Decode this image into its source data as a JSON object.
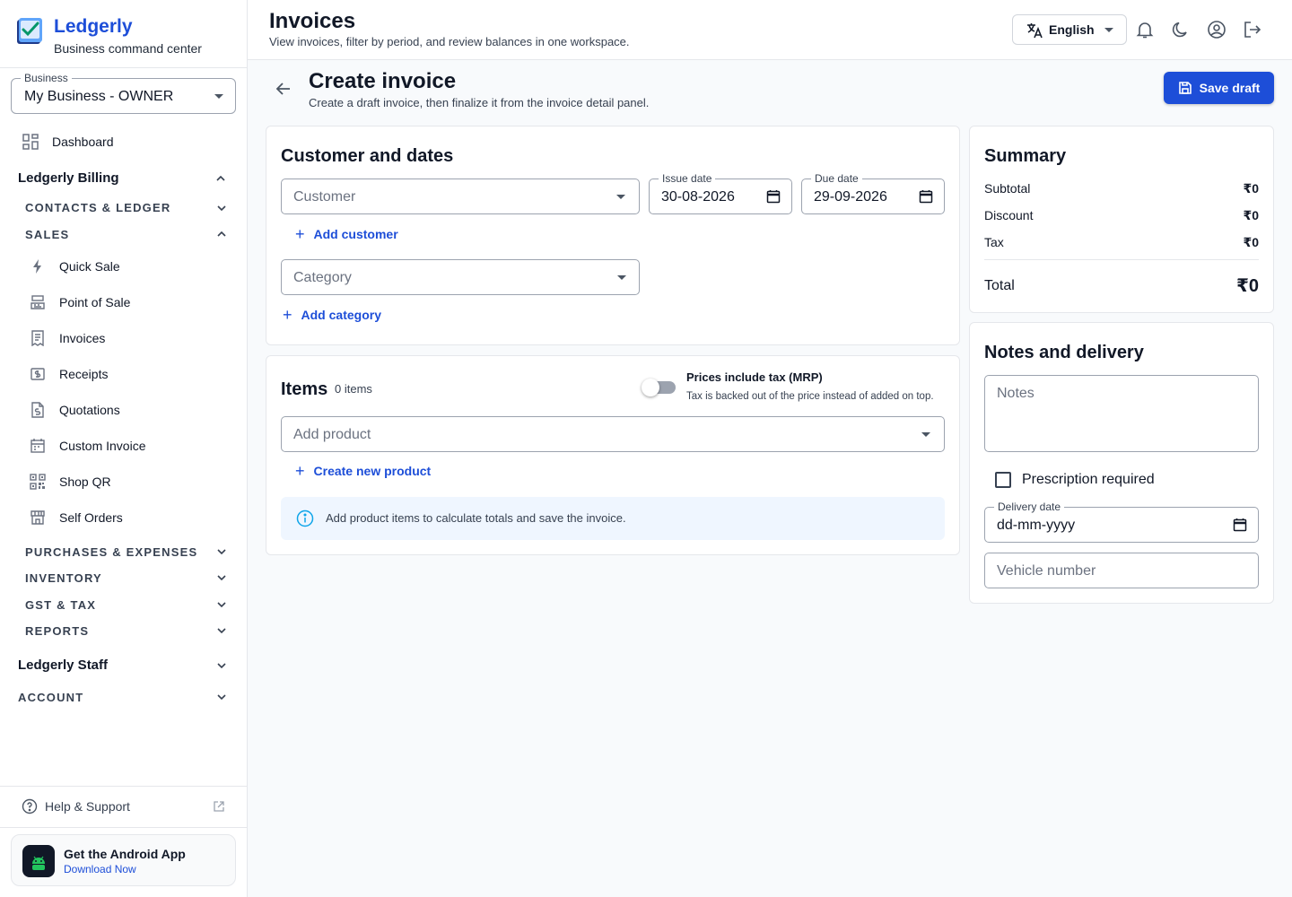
{
  "app": {
    "name": "Ledgerly",
    "tagline": "Business command center"
  },
  "business": {
    "label": "Business",
    "value": "My Business - OWNER"
  },
  "sidebar": {
    "dashboard": "Dashboard",
    "billing_group": "Ledgerly Billing",
    "contacts": "CONTACTS & LEDGER",
    "sales": "SALES",
    "sales_items": [
      {
        "label": "Quick Sale",
        "icon": "bolt-icon"
      },
      {
        "label": "Point of Sale",
        "icon": "register-icon"
      },
      {
        "label": "Invoices",
        "icon": "invoice-icon"
      },
      {
        "label": "Receipts",
        "icon": "receipt-icon"
      },
      {
        "label": "Quotations",
        "icon": "quotation-icon"
      },
      {
        "label": "Custom Invoice",
        "icon": "custom-invoice-icon"
      },
      {
        "label": "Shop QR",
        "icon": "qr-icon"
      },
      {
        "label": "Self Orders",
        "icon": "store-icon"
      }
    ],
    "purchases": "PURCHASES & EXPENSES",
    "inventory": "INVENTORY",
    "gst": "GST & TAX",
    "reports": "REPORTS",
    "staff_group": "Ledgerly Staff",
    "account": "ACCOUNT",
    "help": "Help & Support",
    "app_promo": {
      "title": "Get the Android App",
      "subtitle": "Download Now"
    }
  },
  "header": {
    "title": "Invoices",
    "subtitle": "View invoices, filter by period, and review balances in one workspace.",
    "language": "English"
  },
  "page": {
    "title": "Create invoice",
    "subtitle": "Create a draft invoice, then finalize it from the invoice detail panel.",
    "save_label": "Save draft"
  },
  "customer_card": {
    "title": "Customer and dates",
    "customer_placeholder": "Customer",
    "issue_label": "Issue date",
    "issue_value": "30-08-2026",
    "due_label": "Due date",
    "due_value": "29-09-2026",
    "add_customer": "Add customer",
    "category_placeholder": "Category",
    "add_category": "Add category"
  },
  "items_card": {
    "title": "Items",
    "count": "0 items",
    "tax_toggle_label": "Prices include tax (MRP)",
    "tax_toggle_hint": "Tax is backed out of the price instead of added on top.",
    "tax_toggle_on": false,
    "product_placeholder": "Add product",
    "create_product": "Create new product",
    "info": "Add product items to calculate totals and save the invoice."
  },
  "summary": {
    "title": "Summary",
    "rows": [
      {
        "label": "Subtotal",
        "value": "₹0"
      },
      {
        "label": "Discount",
        "value": "₹0"
      },
      {
        "label": "Tax",
        "value": "₹0"
      }
    ],
    "total_label": "Total",
    "total_value": "₹0"
  },
  "notes": {
    "title": "Notes and delivery",
    "notes_placeholder": "Notes",
    "prescription_label": "Prescription required",
    "prescription_checked": false,
    "delivery_label": "Delivery date",
    "delivery_placeholder": "dd-mm-yyyy",
    "vehicle_placeholder": "Vehicle number"
  },
  "colors": {
    "accent": "#1d4ed8",
    "info_bg": "#eff6ff",
    "surface": "#f8fafc"
  }
}
